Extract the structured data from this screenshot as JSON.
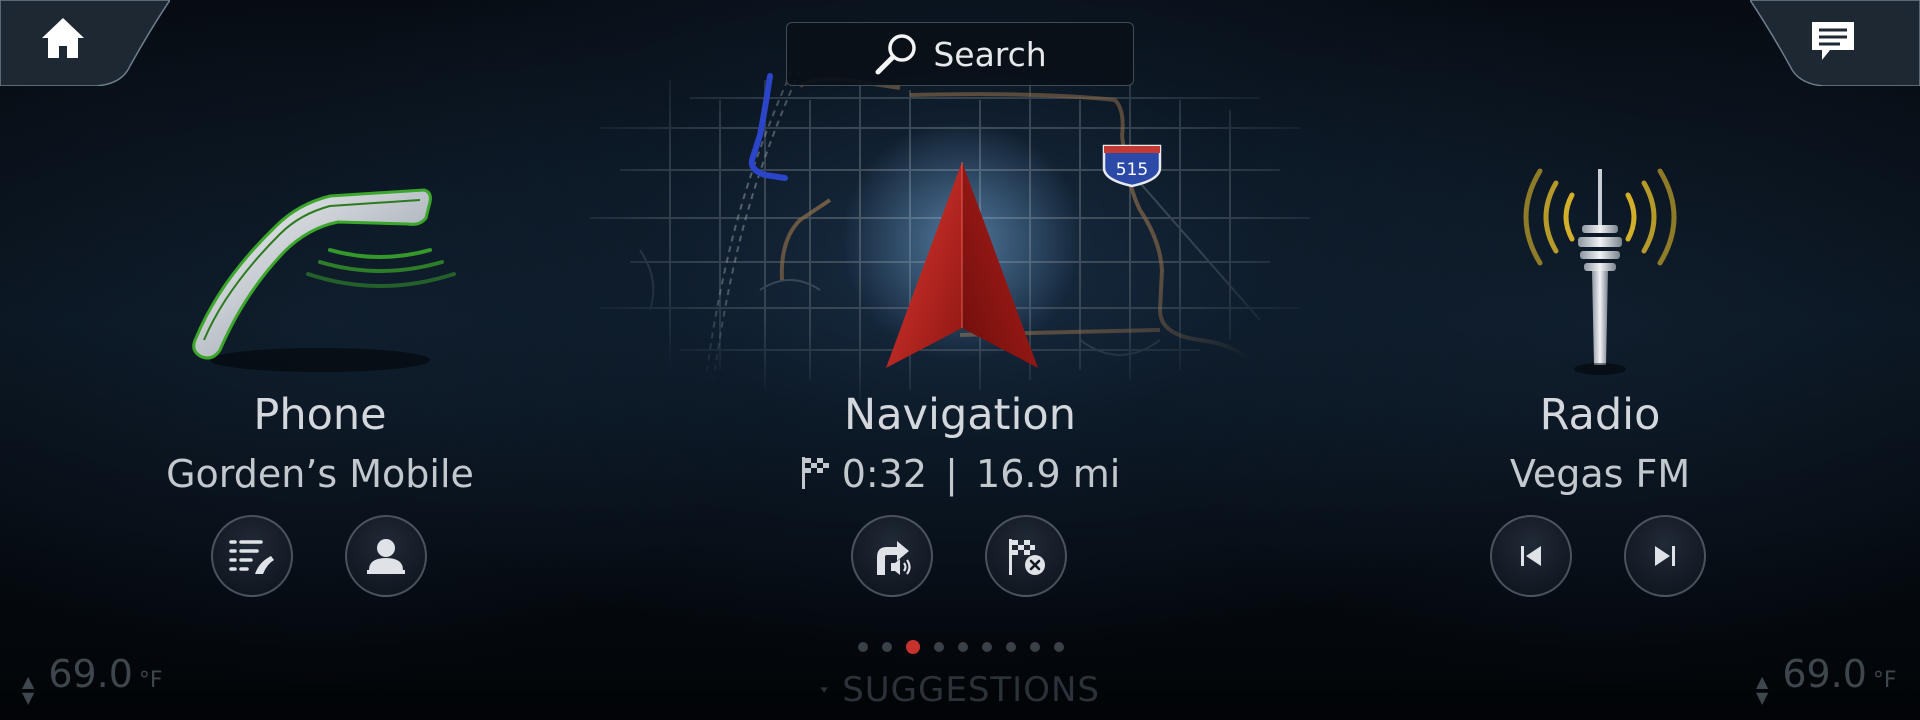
{
  "header": {
    "home_icon": "home-icon",
    "messages_icon": "message-icon",
    "search_label": "Search",
    "search_icon": "search-icon"
  },
  "map": {
    "route_shield": "515"
  },
  "tiles": {
    "phone": {
      "title": "Phone",
      "subtitle": "Gorden’s Mobile",
      "icon": "phone-handset-icon",
      "buttons": [
        "call-list-icon",
        "contact-icon"
      ]
    },
    "navigation": {
      "title": "Navigation",
      "eta": "0:32",
      "separator": "|",
      "distance": "16.9 mi",
      "icon": "navigation-arrow-icon",
      "buttons": [
        "voice-guidance-icon",
        "cancel-route-icon"
      ]
    },
    "radio": {
      "title": "Radio",
      "subtitle": "Vegas FM",
      "icon": "radio-tower-icon",
      "buttons": [
        "previous-station-icon",
        "next-station-icon"
      ]
    }
  },
  "pager": {
    "total": 9,
    "active_index": 2
  },
  "footer": {
    "suggestions_label": "SUGGESTIONS",
    "temp_left": "69.0",
    "temp_right": "69.0",
    "temp_unit": "°F"
  },
  "colors": {
    "accent_red": "#c8322e",
    "route_blue": "#2a45c8",
    "road_orange": "#8a6a48",
    "phone_green": "#3aa62a",
    "radio_gold": "#d4b02a"
  }
}
